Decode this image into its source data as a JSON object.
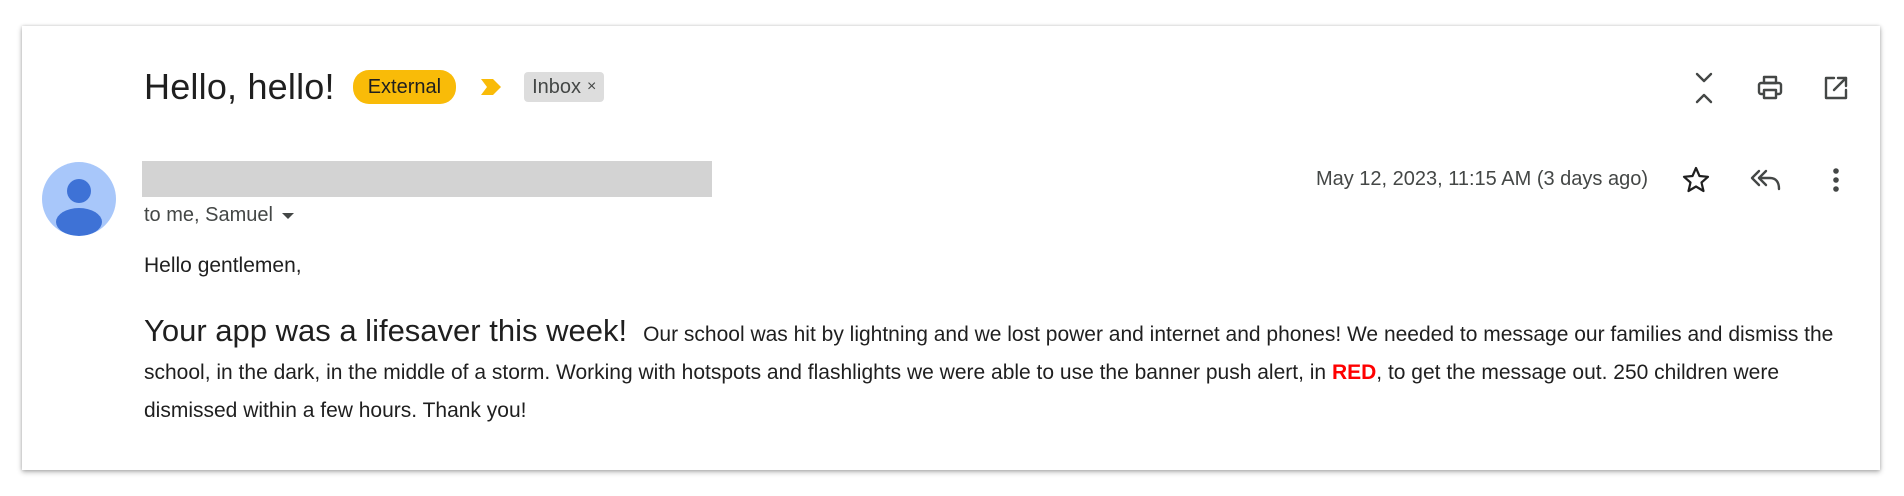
{
  "email": {
    "subject": "Hello, hello!",
    "labels": {
      "external": "External",
      "inbox": "Inbox",
      "inbox_remove": "×"
    },
    "date": "May 12, 2023, 11:15 AM (3 days ago)",
    "to_line": "to me, Samuel",
    "greeting": "Hello gentlemen,",
    "body": {
      "lead": "Your app was a lifesaver this week!",
      "part1": "Our school was hit by lightning and we lost power and internet and phones!  We needed to message our families and dismiss the school, in the dark, in the middle of a storm.  Working with hotspots and flashlights we were able to use the banner push alert, in ",
      "highlight": "RED",
      "part2": ", to get the message out.  250 children were dismissed within a few hours.  Thank you!"
    }
  },
  "colors": {
    "external_badge": "#f9bb08",
    "importance_marker": "#f9bb08",
    "inbox_badge": "#dddddd",
    "avatar_bg": "#a8c7fa",
    "avatar_fg": "#3e72d6",
    "highlight_red": "#ff0000"
  },
  "icons": {
    "header": [
      "collapse-all-icon",
      "print-icon",
      "open-in-new-window-icon"
    ],
    "row": [
      "star-icon",
      "reply-all-icon",
      "more-vert-icon"
    ]
  }
}
